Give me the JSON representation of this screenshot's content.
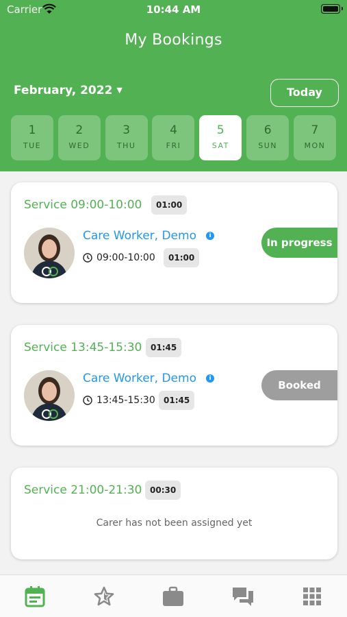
{
  "status_bar": {
    "carrier": "Carrier",
    "time": "10:44 AM"
  },
  "header": {
    "title": "My Bookings",
    "month": "February, 2022",
    "today_label": "Today"
  },
  "days": [
    {
      "num": "1",
      "name": "TUE"
    },
    {
      "num": "2",
      "name": "WED"
    },
    {
      "num": "3",
      "name": "THU"
    },
    {
      "num": "4",
      "name": "FRI"
    },
    {
      "num": "5",
      "name": "SAT",
      "selected": true
    },
    {
      "num": "6",
      "name": "SUN"
    },
    {
      "num": "7",
      "name": "MON"
    }
  ],
  "bookings": [
    {
      "title": "Service 09:00-10:00",
      "duration": "01:00",
      "worker": "Care Worker, Demo",
      "time": "09:00-10:00",
      "time_duration": "01:00",
      "status": "In progress"
    },
    {
      "title": "Service 13:45-15:30",
      "duration": "01:45",
      "worker": "Care Worker, Demo",
      "time": "13:45-15:30",
      "time_duration": "01:45",
      "status": "Booked"
    },
    {
      "title": "Service 21:00-21:30",
      "duration": "00:30",
      "message": "Carer has not been assigned yet"
    }
  ],
  "colors": {
    "brand_green": "#52b152",
    "link_blue": "#2196f3",
    "booked_gray": "#9e9e9e",
    "active_tab": "#52b152",
    "inactive_tab": "#8a8a8a"
  },
  "tabs": [
    {
      "icon": "calendar-icon",
      "active": true
    },
    {
      "icon": "star-icon"
    },
    {
      "icon": "briefcase-icon"
    },
    {
      "icon": "chat-icon"
    },
    {
      "icon": "grid-menu-icon"
    }
  ]
}
